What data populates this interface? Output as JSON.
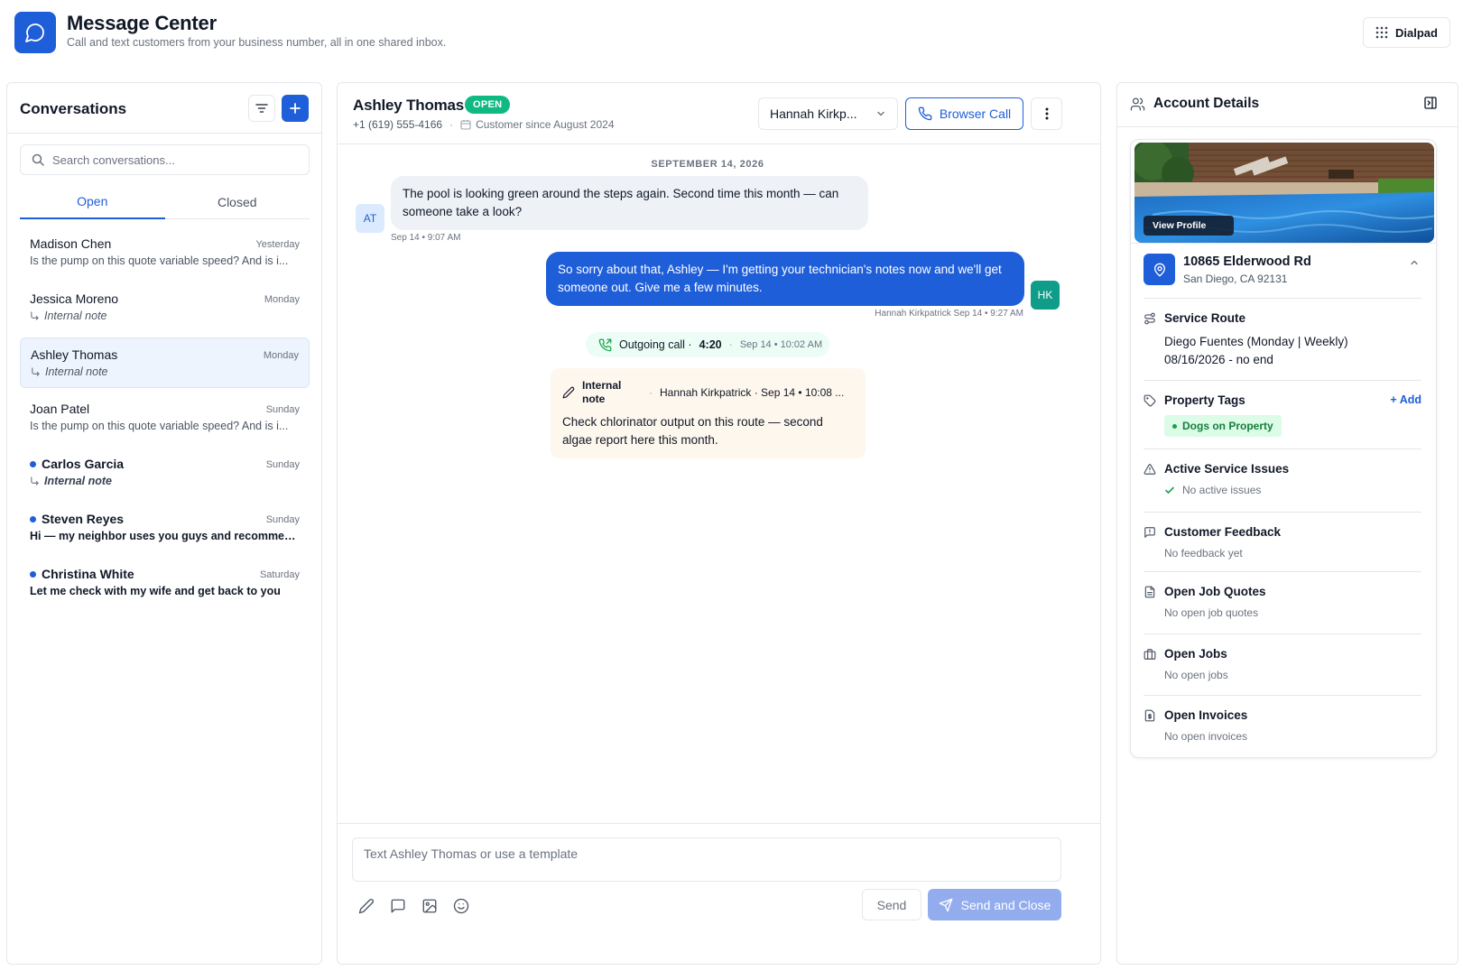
{
  "app": {
    "title": "Message Center",
    "subtitle": "Call and text customers from your business number, all in one shared inbox.",
    "dialpad_label": "Dialpad",
    "logo_icon": "chat-bubble-icon",
    "accent": "#1f5ed9"
  },
  "conversations": {
    "title": "Conversations",
    "search_placeholder": "Search conversations...",
    "tabs": [
      {
        "label": "Open",
        "active": true
      },
      {
        "label": "Closed",
        "active": false
      }
    ],
    "items": [
      {
        "name": "Madison Chen",
        "date": "Yesterday",
        "preview": "Is the pump on this quote variable speed? And is i...",
        "is_note": false,
        "unread": false,
        "selected": false
      },
      {
        "name": "Jessica Moreno",
        "date": "Monday",
        "preview": "Internal note",
        "is_note": true,
        "unread": false,
        "selected": false
      },
      {
        "name": "Ashley Thomas",
        "date": "Monday",
        "preview": "Internal note",
        "is_note": true,
        "unread": false,
        "selected": true
      },
      {
        "name": "Joan Patel",
        "date": "Sunday",
        "preview": "Is the pump on this quote variable speed? And is i...",
        "is_note": false,
        "unread": false,
        "selected": false
      },
      {
        "name": "Carlos Garcia",
        "date": "Sunday",
        "preview": "Internal note",
        "is_note": true,
        "unread": true,
        "selected": false
      },
      {
        "name": "Steven Reyes",
        "date": "Sunday",
        "preview": "Hi — my neighbor uses you guys and recommen...",
        "is_note": false,
        "unread": true,
        "selected": false
      },
      {
        "name": "Christina White",
        "date": "Saturday",
        "preview": "Let me check with my wife and get back to you",
        "is_note": false,
        "unread": true,
        "selected": false
      }
    ]
  },
  "chat": {
    "contact_name": "Ashley Thomas",
    "status": "OPEN",
    "phone": "+1 (619) 555-4166",
    "customer_since": "Customer since August 2024",
    "assignee": "Hannah Kirkp...",
    "call_button": "Browser Call",
    "day_separator": "SEPTEMBER 14, 2026",
    "messages": [
      {
        "from": "customer",
        "initials": "AT",
        "text": "The pool is looking green around the steps again. Second time this month — can someone take a look?",
        "meta": "Sep 14 • 9:07 AM"
      },
      {
        "from": "agent",
        "initials": "HK",
        "text": "So sorry about that, Ashley — I'm getting your technician's notes now and we'll get someone out. Give me a few minutes.",
        "author": "Hannah Kirkpatrick",
        "meta": "Sep 14 • 9:27 AM"
      }
    ],
    "call_event": {
      "label": "Outgoing call ·",
      "duration": "4:20",
      "time": "Sep 14 • 10:02 AM"
    },
    "internal_note": {
      "label": "Internal note",
      "author": "Hannah Kirkpatrick · Sep 14 • 10:08 ...",
      "text": "Check chlorinator output on this route — second algae report here this month."
    },
    "composer_placeholder": "Text Ashley Thomas or use a template",
    "send_label": "Send",
    "send_close_label": "Send and Close"
  },
  "account": {
    "title": "Account Details",
    "view_profile": "View Profile",
    "address_street": "10865 Elderwood Rd",
    "address_city": "San Diego, CA 92131",
    "service_route_title": "Service Route",
    "service_route_line1": "Diego Fuentes (Monday | Weekly)",
    "service_route_line2": "08/16/2026 - no end",
    "tags_title": "Property Tags",
    "add_label": "+ Add",
    "tag": "Dogs on Property",
    "issues_title": "Active Service Issues",
    "issues_value": "No active issues",
    "feedback_title": "Customer Feedback",
    "feedback_value": "No feedback yet",
    "quotes_title": "Open Job Quotes",
    "quotes_value": "No open job quotes",
    "jobs_title": "Open Jobs",
    "jobs_value": "No open jobs",
    "invoices_title": "Open Invoices",
    "invoices_value": "No open invoices"
  }
}
